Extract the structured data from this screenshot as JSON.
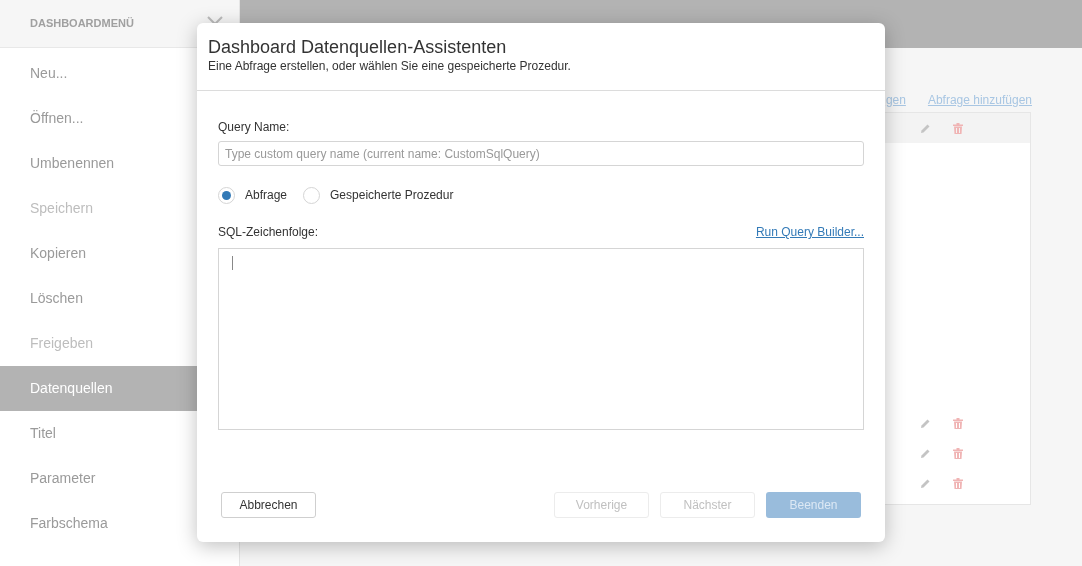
{
  "sidebar": {
    "title": "DASHBOARDMENÜ",
    "items": [
      {
        "label": "Neu...",
        "selected": false,
        "disabled": false
      },
      {
        "label": "Öffnen...",
        "selected": false,
        "disabled": false
      },
      {
        "label": "Umbenennen",
        "selected": false,
        "disabled": false
      },
      {
        "label": "Speichern",
        "selected": false,
        "disabled": true
      },
      {
        "label": "Kopieren",
        "selected": false,
        "disabled": false
      },
      {
        "label": "Löschen",
        "selected": false,
        "disabled": false
      },
      {
        "label": "Freigeben",
        "selected": false,
        "disabled": true
      },
      {
        "label": "Datenquellen",
        "selected": true,
        "disabled": false
      },
      {
        "label": "Titel",
        "selected": false,
        "disabled": false
      },
      {
        "label": "Parameter",
        "selected": false,
        "disabled": false
      },
      {
        "label": "Farbschema",
        "selected": false,
        "disabled": false
      }
    ]
  },
  "background_panel": {
    "links": [
      "gen",
      "Abfrage hinzufügen"
    ]
  },
  "dialog": {
    "title": "Dashboard Datenquellen-Assistenten",
    "subtitle": "Eine Abfrage erstellen, oder wählen Sie eine gespeicherte Prozedur.",
    "query_name": {
      "label": "Query Name:",
      "placeholder": "Type custom query name (current name: CustomSqlQuery)"
    },
    "options": [
      {
        "label": "Abfrage",
        "selected": true
      },
      {
        "label": "Gespeicherte Prozedur",
        "selected": false
      }
    ],
    "sql": {
      "label": "SQL-Zeichenfolge:",
      "link": "Run Query Builder..."
    },
    "buttons": [
      {
        "label": "Abbrechen",
        "kind": "secondary",
        "disabled": false
      },
      {
        "label": "Vorherige",
        "kind": "secondary",
        "disabled": true
      },
      {
        "label": "Nächster",
        "kind": "secondary",
        "disabled": true
      },
      {
        "label": "Beenden",
        "kind": "primary",
        "disabled": true
      }
    ]
  }
}
